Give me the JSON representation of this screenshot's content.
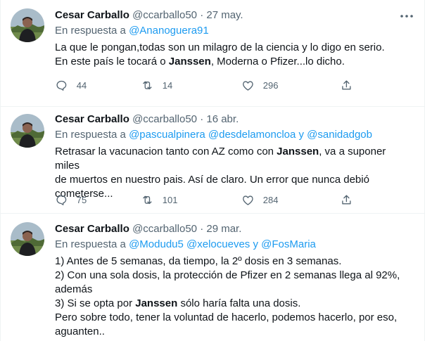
{
  "tweets": [
    {
      "name": "Cesar Carballo",
      "handle": "@ccarballo50",
      "dot": "·",
      "date": "27 may.",
      "reply_prefix": "En respuesta a",
      "reply_mentions": "@Ananoguera91",
      "lines": [
        {
          "pre": "La que le pongan,todas son un milagro de la ciencia y lo digo en serio.",
          "bold": "",
          "post": ""
        },
        {
          "pre": "En este país le tocará o ",
          "bold": "Janssen",
          "post": ", Moderna o Pfizer...lo dicho."
        }
      ],
      "replies": "44",
      "retweets": "14",
      "likes": "296"
    },
    {
      "name": "Cesar Carballo",
      "handle": "@ccarballo50",
      "dot": "·",
      "date": "16 abr.",
      "reply_prefix": "En respuesta a",
      "reply_mentions": "@pascualpinera @desdelamoncloa y @sanidadgob",
      "lines": [
        {
          "pre": "Retrasar la vacunacion tanto con AZ como con ",
          "bold": "Janssen",
          "post": ", va a suponer miles"
        },
        {
          "pre": "de muertos en nuestro pais. Así de claro. Un error que nunca debió",
          "bold": "",
          "post": ""
        },
        {
          "pre": "cometerse...",
          "bold": "",
          "post": ""
        }
      ],
      "replies": "75",
      "retweets": "101",
      "likes": "284"
    },
    {
      "name": "Cesar Carballo",
      "handle": "@ccarballo50",
      "dot": "·",
      "date": "29 mar.",
      "reply_prefix": "En respuesta a",
      "reply_mentions": "@Modudu5 @xelocueves y @FosMaria",
      "lines": [
        {
          "pre": "1) Antes de 5 semanas, da tiempo, la 2º dosis en 3 semanas.",
          "bold": "",
          "post": ""
        },
        {
          "pre": "2) Con una sola dosis, la protección de Pfizer en 2 semanas llega al 92%,",
          "bold": "",
          "post": ""
        },
        {
          "pre": "además",
          "bold": "",
          "post": ""
        },
        {
          "pre": "3) Si se opta por ",
          "bold": "Janssen",
          "post": " sólo haría falta una dosis."
        },
        {
          "pre": "Pero sobre todo, tener la voluntad de hacerlo, podemos hacerlo, por eso,",
          "bold": "",
          "post": ""
        },
        {
          "pre": "aguanten..",
          "bold": "",
          "post": ""
        }
      ]
    }
  ],
  "icons": {
    "reply": "comment-icon",
    "retweet": "retweet-icon",
    "like": "heart-icon",
    "share": "share-icon",
    "more": "more-icon"
  },
  "colors": {
    "text": "#0f1419",
    "secondary": "#536471",
    "link": "#1d9bf0",
    "divider": "#eff3f4"
  }
}
